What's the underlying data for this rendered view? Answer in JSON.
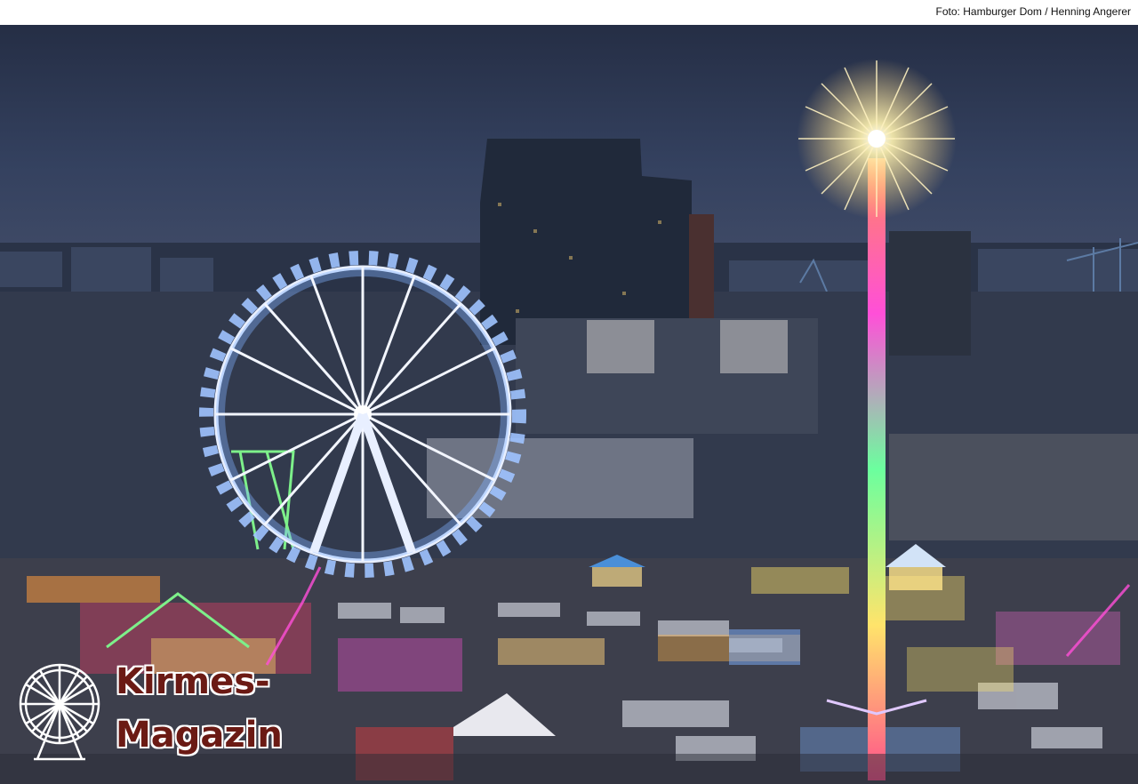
{
  "credit": {
    "text": "Foto: Hamburger Dom / Henning Angerer"
  },
  "logo": {
    "line1": "Kirmes-",
    "line2": "Magazin"
  },
  "photo": {
    "subject": "ferris-wheel-and-drop-tower-at-night-fair",
    "sky_color": "#2b3550",
    "accent_colors": [
      "#7fb2ff",
      "#ff4fd8",
      "#ffe46b",
      "#48f0a0"
    ]
  }
}
